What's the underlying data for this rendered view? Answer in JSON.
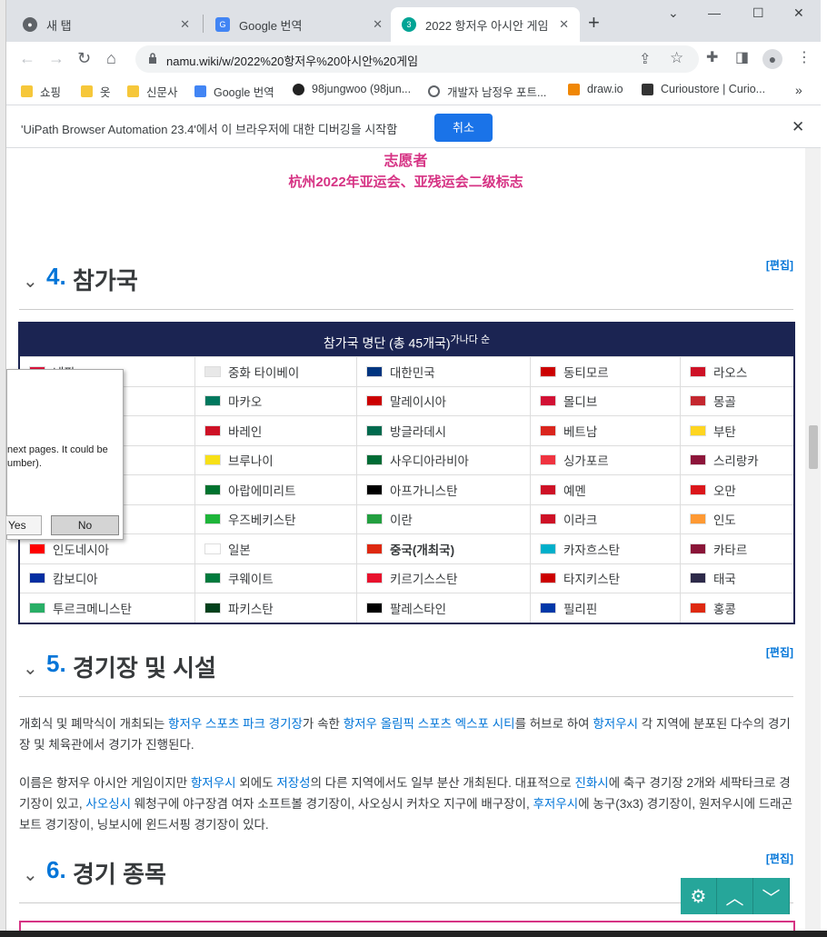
{
  "tabs": [
    {
      "label": "새 탭"
    },
    {
      "label": "Google 번역"
    },
    {
      "label": "2022 항저우 아시안 게임"
    }
  ],
  "address": {
    "url": "namu.wiki/w/2022%20항저우%20아시안%20게임"
  },
  "bookmarks": [
    "쇼핑",
    "옷",
    "신문사",
    "Google 번역",
    "98jungwoo (98jun...",
    "개발자 남정우 포트...",
    "draw.io",
    "Curioustore | Curio..."
  ],
  "infobar": {
    "text": "'UiPath Browser Automation 23.4'에서 이 브라우저에 대한 디버깅을 시작함",
    "cancel": "취소"
  },
  "logo_text": {
    "line1": "志愿者",
    "line2": "杭州2022年亚运会、亚残运会二级标志"
  },
  "section4": {
    "num": "4.",
    "title": "참가국",
    "edit": "[편집]"
  },
  "table": {
    "header": "참가국 명단 (총 45개국)",
    "header_sup": "가나다 순",
    "rows": [
      [
        "네팔",
        "중화 타이베이",
        "대한민국",
        "동티모르",
        "라오스"
      ],
      [
        "",
        "마카오",
        "말레이시아",
        "몰디브",
        "몽골"
      ],
      [
        "",
        "바레인",
        "방글라데시",
        "베트남",
        "부탄"
      ],
      [
        "",
        "브루나이",
        "사우디아라비아",
        "싱가포르",
        "스리랑카"
      ],
      [
        "",
        "아랍에미리트",
        "아프가니스탄",
        "예멘",
        "오만"
      ],
      [
        "",
        "우즈베키스탄",
        "이란",
        "이라크",
        "인도"
      ],
      [
        "인도네시아",
        "일본",
        "중국(개최국)",
        "카자흐스탄",
        "카타르"
      ],
      [
        "캄보디아",
        "쿠웨이트",
        "키르기스스탄",
        "타지키스탄",
        "태국"
      ],
      [
        "투르크메니스탄",
        "파키스탄",
        "팔레스타인",
        "필리핀",
        "홍콩"
      ]
    ]
  },
  "section5": {
    "num": "5.",
    "title": "경기장 및 시설",
    "edit": "[편집]"
  },
  "para1": {
    "t1": "개회식 및 폐막식이 개최되는 ",
    "l1": "항저우 스포츠 파크 경기장",
    "t2": "가 속한 ",
    "l2": "항저우 올림픽 스포츠 엑스포 시티",
    "t3": "를 허브로 하여 ",
    "l3": "항저우시",
    "t4": " 각 지역에 분포된 다수의 경기장 및 체육관에서 경기가 진행된다."
  },
  "para2": {
    "t1": "이름은 항저우 아시안 게임이지만 ",
    "l1": "항저우시",
    "t2": " 외에도 ",
    "l2": "저장성",
    "t3": "의 다른 지역에서도 일부 분산 개최된다. 대표적으로 ",
    "l3": "진화시",
    "t4": "에 축구 경기장 2개와 세팍타크로 경기장이 있고, ",
    "l4": "사오싱시",
    "t5": " 웨청구에 야구장겸 여자 소프트볼 경기장이, 사오싱시 커차오 지구에 배구장이, ",
    "l5": "후저우시",
    "t6": "에 농구(3x3) 경기장이, 원저우시에 드래곤보트 경기장이, 닝보시에 윈드서핑 경기장이 있다."
  },
  "section6": {
    "num": "6.",
    "title": "경기 종목",
    "edit": "[편집]"
  },
  "dialog": {
    "line1": "next pages. It could be",
    "line2": "umber).",
    "yes": "Yes",
    "no": "No"
  }
}
